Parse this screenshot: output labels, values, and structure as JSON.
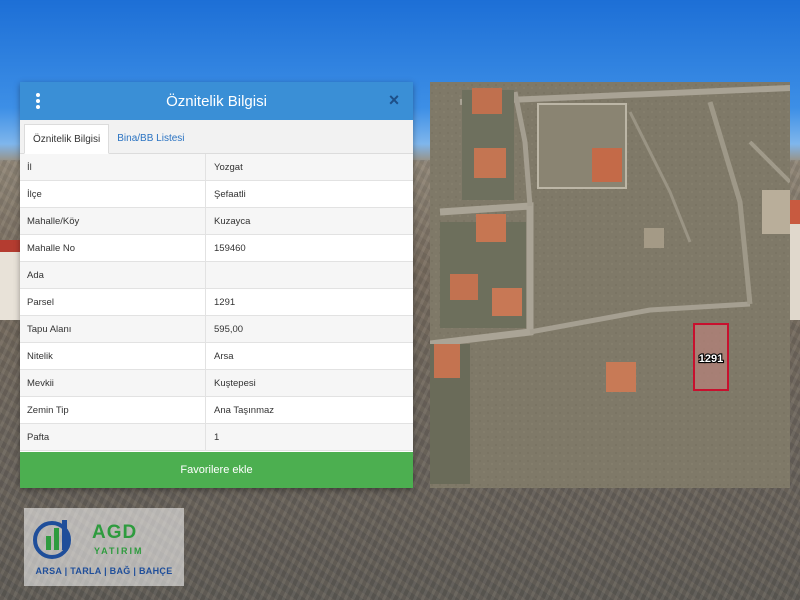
{
  "panel": {
    "title": "Öznitelik Bilgisi",
    "close_label": "×",
    "tabs": [
      {
        "label": "Öznitelik Bilgisi",
        "active": true
      },
      {
        "label": "Bina/BB Listesi",
        "active": false
      }
    ],
    "rows": [
      {
        "key": "İl",
        "value": "Yozgat"
      },
      {
        "key": "İlçe",
        "value": "Şefaatli"
      },
      {
        "key": "Mahalle/Köy",
        "value": "Kuzayca"
      },
      {
        "key": "Mahalle No",
        "value": "159460"
      },
      {
        "key": "Ada",
        "value": ""
      },
      {
        "key": "Parsel",
        "value": "1291"
      },
      {
        "key": "Tapu Alanı",
        "value": "595,00"
      },
      {
        "key": "Nitelik",
        "value": "Arsa"
      },
      {
        "key": "Mevkii",
        "value": "Kuştepesi"
      },
      {
        "key": "Zemin Tip",
        "value": "Ana Taşınmaz"
      },
      {
        "key": "Pafta",
        "value": "1"
      }
    ],
    "favorite_button_label": "Favorilere ekle",
    "header_color": "#3a8fd6",
    "button_color": "#4caf50"
  },
  "map": {
    "parcel_label": "1291",
    "parcel_color": "#c8102e"
  },
  "logo": {
    "name": "AGD",
    "subtitle": "YATIRIM",
    "tagline": "ARSA | TARLA | BAĞ | BAHÇE"
  }
}
